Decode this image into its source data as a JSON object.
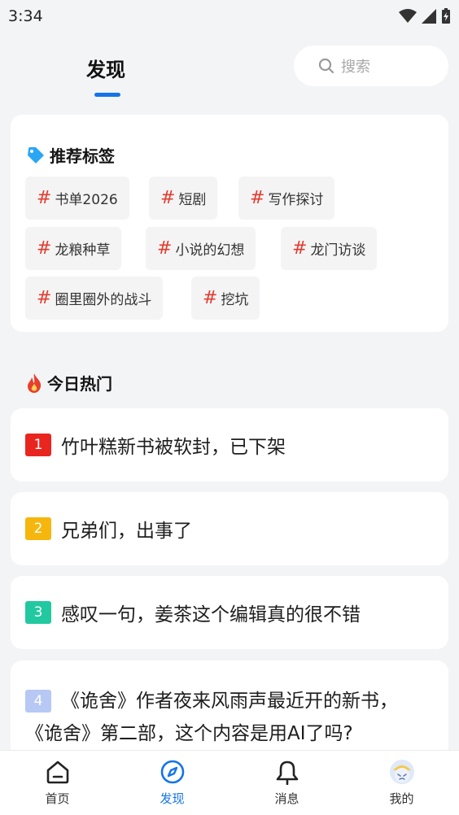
{
  "status_bar": {
    "time": "3:34"
  },
  "header": {
    "title": "发现",
    "search_placeholder": "搜索"
  },
  "tags_section": {
    "title": "推荐标签",
    "hash_symbol": "#",
    "tags": [
      "书单2026",
      "短剧",
      "写作探讨",
      "龙粮种草",
      "小说的幻想",
      "龙门访谈",
      "圈里圈外的战斗",
      "挖坑"
    ]
  },
  "hot_section": {
    "title": "今日热门",
    "items": [
      {
        "rank": "1",
        "text": "竹叶糕新书被软封，已下架",
        "color": "#e8261f"
      },
      {
        "rank": "2",
        "text": "兄弟们，出事了",
        "color": "#f5b70d"
      },
      {
        "rank": "3",
        "text": "感叹一句，姜茶这个编辑真的很不错",
        "color": "#22c9a0"
      },
      {
        "rank": "4",
        "text": "《诡舍》作者夜来风雨声最近开的新书，",
        "text2": "《诡舍》第二部，这个内容是用AI了吗?",
        "color": "#b7c8f4"
      }
    ]
  },
  "bottom_nav": {
    "items": [
      {
        "label": "首页",
        "icon": "home-icon"
      },
      {
        "label": "发现",
        "icon": "compass-icon"
      },
      {
        "label": "消息",
        "icon": "bell-icon"
      },
      {
        "label": "我的",
        "icon": "avatar-icon"
      }
    ]
  },
  "colors": {
    "accent": "#1474ea",
    "hash": "#e33c2f"
  }
}
